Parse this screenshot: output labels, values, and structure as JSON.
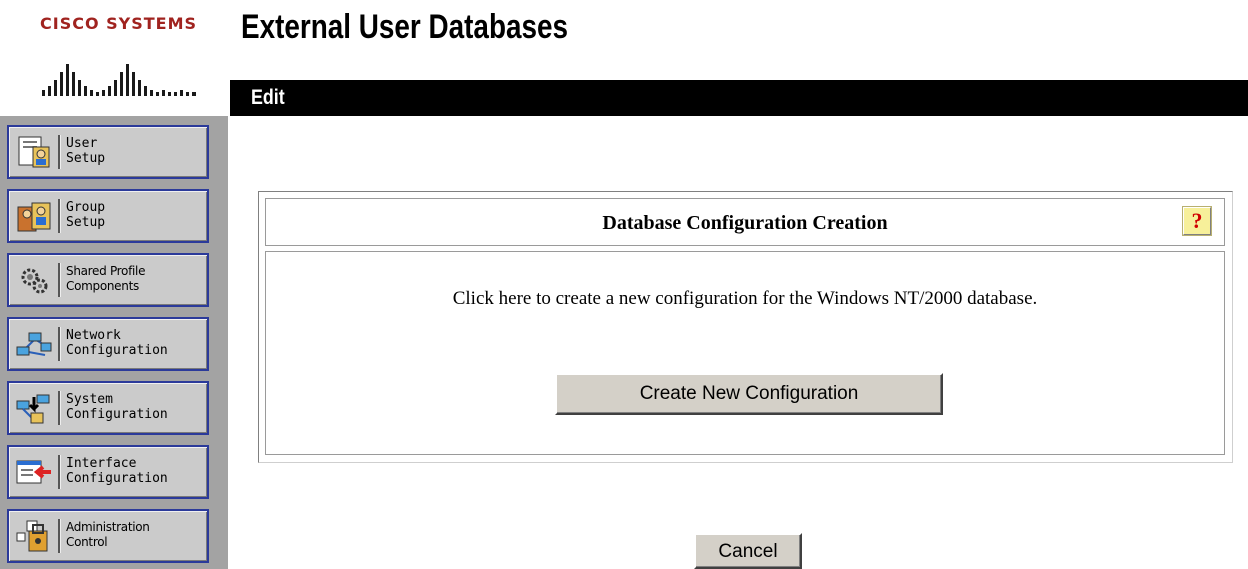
{
  "logo": {
    "text": "CISCO SYSTEMS"
  },
  "header": {
    "title": "External User Databases",
    "section": "Edit"
  },
  "sidebar": {
    "items": [
      {
        "label": "User\nSetup",
        "icon": "user-setup-icon"
      },
      {
        "label": "Group\nSetup",
        "icon": "group-setup-icon"
      },
      {
        "label": "Shared Profile\nComponents",
        "icon": "shared-profile-icon"
      },
      {
        "label": "Network\nConfiguration",
        "icon": "network-configuration-icon"
      },
      {
        "label": "System\nConfiguration",
        "icon": "system-configuration-icon"
      },
      {
        "label": "Interface\nConfiguration",
        "icon": "interface-configuration-icon"
      },
      {
        "label": "Administration\nControl",
        "icon": "administration-control-icon"
      }
    ]
  },
  "main": {
    "table_title": "Database Configuration Creation",
    "help_label": "?",
    "instruction": "Click here to create a new configuration for the Windows NT/2000 database.",
    "create_label": "Create New Configuration",
    "cancel_label": "Cancel"
  },
  "colors": {
    "logo_red": "#a0231f",
    "sidebar_bg": "#a3a3a3",
    "nav_border": "#2b3a9a",
    "header_bar": "#000000",
    "help_bg": "#f7f09a"
  }
}
